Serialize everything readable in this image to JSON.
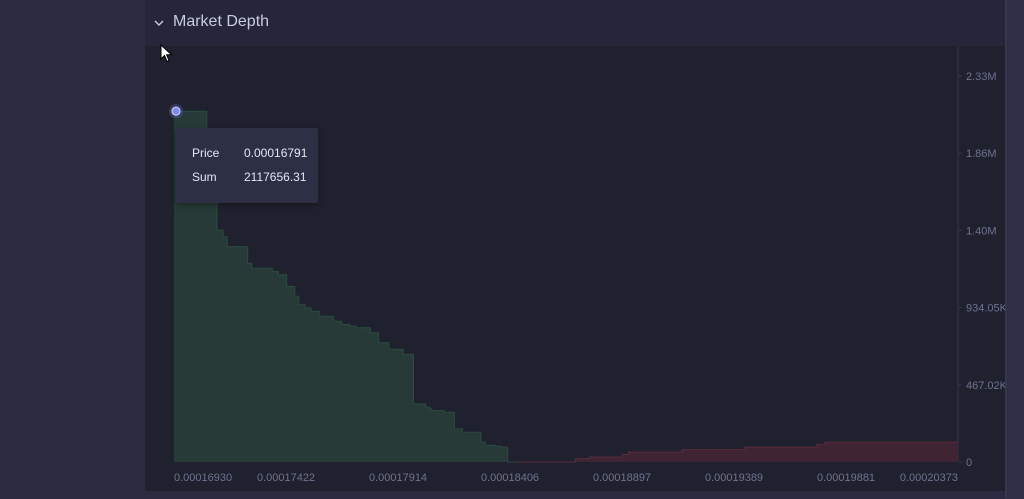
{
  "panel": {
    "title": "Market Depth"
  },
  "tooltip": {
    "price_label": "Price",
    "price_value": "0.00016791",
    "sum_label": "Sum",
    "sum_value": "2117656.31"
  },
  "colors": {
    "bid_fill": "#273a37",
    "bid_line": "#2b4a3f",
    "ask_fill": "#3f2533",
    "ask_line": "#5a2a3c",
    "axis_text": "#6f7290",
    "marker": "#7e8bea"
  },
  "icons": {
    "collapse": "chevron-down-icon",
    "pointer": "mouse-cursor-icon"
  },
  "chart_data": {
    "type": "area",
    "title": "Market Depth",
    "x_tick_labels": [
      "0.00016930",
      "0.00017422",
      "0.00017914",
      "0.00018406",
      "0.00018897",
      "0.00019389",
      "0.00019881",
      "0.00020373"
    ],
    "y_tick_labels": [
      "0",
      "467.02K",
      "934.05K",
      "1.40M",
      "1.86M",
      "2.33M"
    ],
    "xlim": [
      0.0001674,
      0.0002057
    ],
    "ylim": [
      0,
      2330000
    ],
    "grid": false,
    "series": [
      {
        "side": "bids",
        "price": [
          0.0001674,
          0.0001677,
          0.0001679,
          0.000168,
          0.0001685,
          0.0001687,
          0.000169,
          0.0001695,
          0.0001698,
          0.00017,
          0.000171,
          0.0001712,
          0.0001722,
          0.0001725,
          0.0001729,
          0.0001733,
          0.0001735,
          0.0001738,
          0.0001741,
          0.0001745,
          0.0001752,
          0.0001756,
          0.000176,
          0.0001763,
          0.000177,
          0.0001774,
          0.0001779,
          0.0001786,
          0.0001791,
          0.0001797,
          0.0001799,
          0.00018,
          0.0001806,
          0.0001811,
          0.0001815,
          0.0001824,
          0.0001826,
          0.0001831,
          0.0001834,
          0.0001837,
          0.0001842
        ],
        "sum": [
          2117656,
          2117656,
          2117656,
          2117656,
          2117656,
          2117656,
          1840000,
          1400000,
          1360000,
          1300000,
          1200000,
          1170000,
          1150000,
          1130000,
          1060000,
          1000000,
          950000,
          930000,
          910000,
          880000,
          850000,
          830000,
          820000,
          810000,
          780000,
          720000,
          680000,
          650000,
          350000,
          330000,
          320000,
          310000,
          300000,
          200000,
          180000,
          120000,
          100000,
          95000,
          90000,
          0,
          0
        ]
      },
      {
        "side": "asks",
        "price": [
          0.0001842,
          0.0001866,
          0.000187,
          0.0001877,
          0.0001893,
          0.0001894,
          0.0001896,
          0.0001918,
          0.0001922,
          0.0001948,
          0.0001953,
          0.0001984,
          0.0001988,
          0.0001992,
          0.0002037,
          0.0002057
        ],
        "sum": [
          0,
          0,
          20000,
          30000,
          45000,
          45000,
          60000,
          60000,
          75000,
          75000,
          90000,
          90000,
          105000,
          120000,
          120000,
          120000
        ]
      }
    ]
  }
}
